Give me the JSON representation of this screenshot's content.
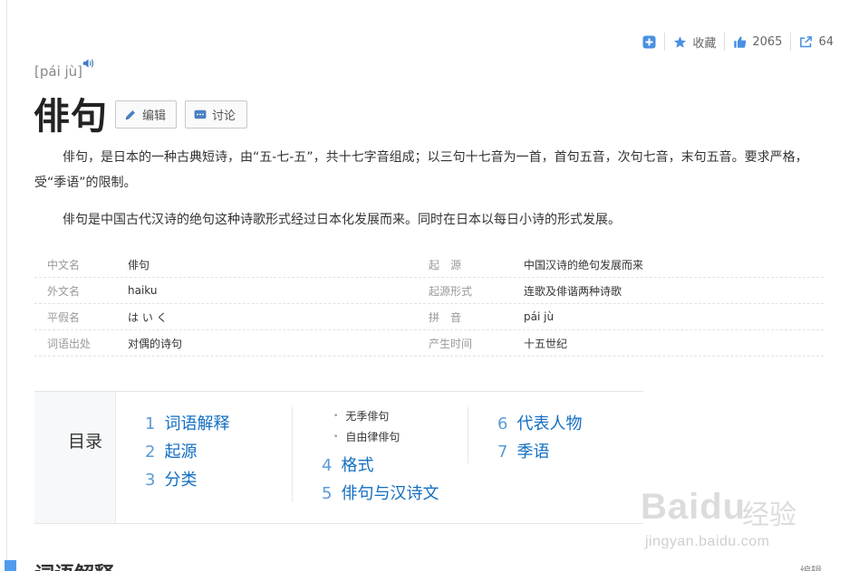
{
  "toolbar": {
    "add_icon": "plus-square-icon",
    "favorite_label": "收藏",
    "like_count": "2065",
    "share_count": "64"
  },
  "entry": {
    "pinyin": "[pái jù]",
    "title": "俳句",
    "edit_label": "编辑",
    "discuss_label": "讨论"
  },
  "summary": {
    "paragraph1": "俳句，是日本的一种古典短诗，由“五-七-五”，共十七字音组成；以三句十七音为一首，首句五音，次句七音，末句五音。要求严格，受“季语”的限制。",
    "paragraph2": "俳句是中国古代汉诗的绝句这种诗歌形式经过日本化发展而来。同时在日本以每日小诗的形式发展。"
  },
  "basic_info": [
    {
      "name": "中文名",
      "value": "俳句",
      "name2": "起　源",
      "value2": "中国汉诗的绝句发展而来"
    },
    {
      "name": "外文名",
      "value": "haiku",
      "name2": "起源形式",
      "value2": "连歌及俳谐两种诗歌"
    },
    {
      "name": "平假名",
      "value": "は い く",
      "name2": "拼　音",
      "value2": "pái jù"
    },
    {
      "name": "词语出处",
      "value": "对偶的诗句",
      "name2": "产生时间",
      "value2": "十五世纪"
    }
  ],
  "catalog": {
    "label": "目录",
    "items": [
      {
        "num": "1",
        "label": "词语解释"
      },
      {
        "num": "2",
        "label": "起源"
      },
      {
        "num": "3",
        "label": "分类"
      },
      {
        "num": "4",
        "label": "格式"
      },
      {
        "num": "5",
        "label": "俳句与汉诗文"
      },
      {
        "num": "6",
        "label": "代表人物"
      },
      {
        "num": "7",
        "label": "季语"
      }
    ],
    "subitems": [
      "无季俳句",
      "自由律俳句"
    ]
  },
  "watermark": {
    "logo": "Baidu",
    "cn": "经验",
    "url": "jingyan.baidu.com"
  },
  "section": {
    "title": "词语解释",
    "edit_label": "编辑"
  },
  "colors": {
    "link": "#136ec2",
    "accent": "#4f9cee"
  }
}
